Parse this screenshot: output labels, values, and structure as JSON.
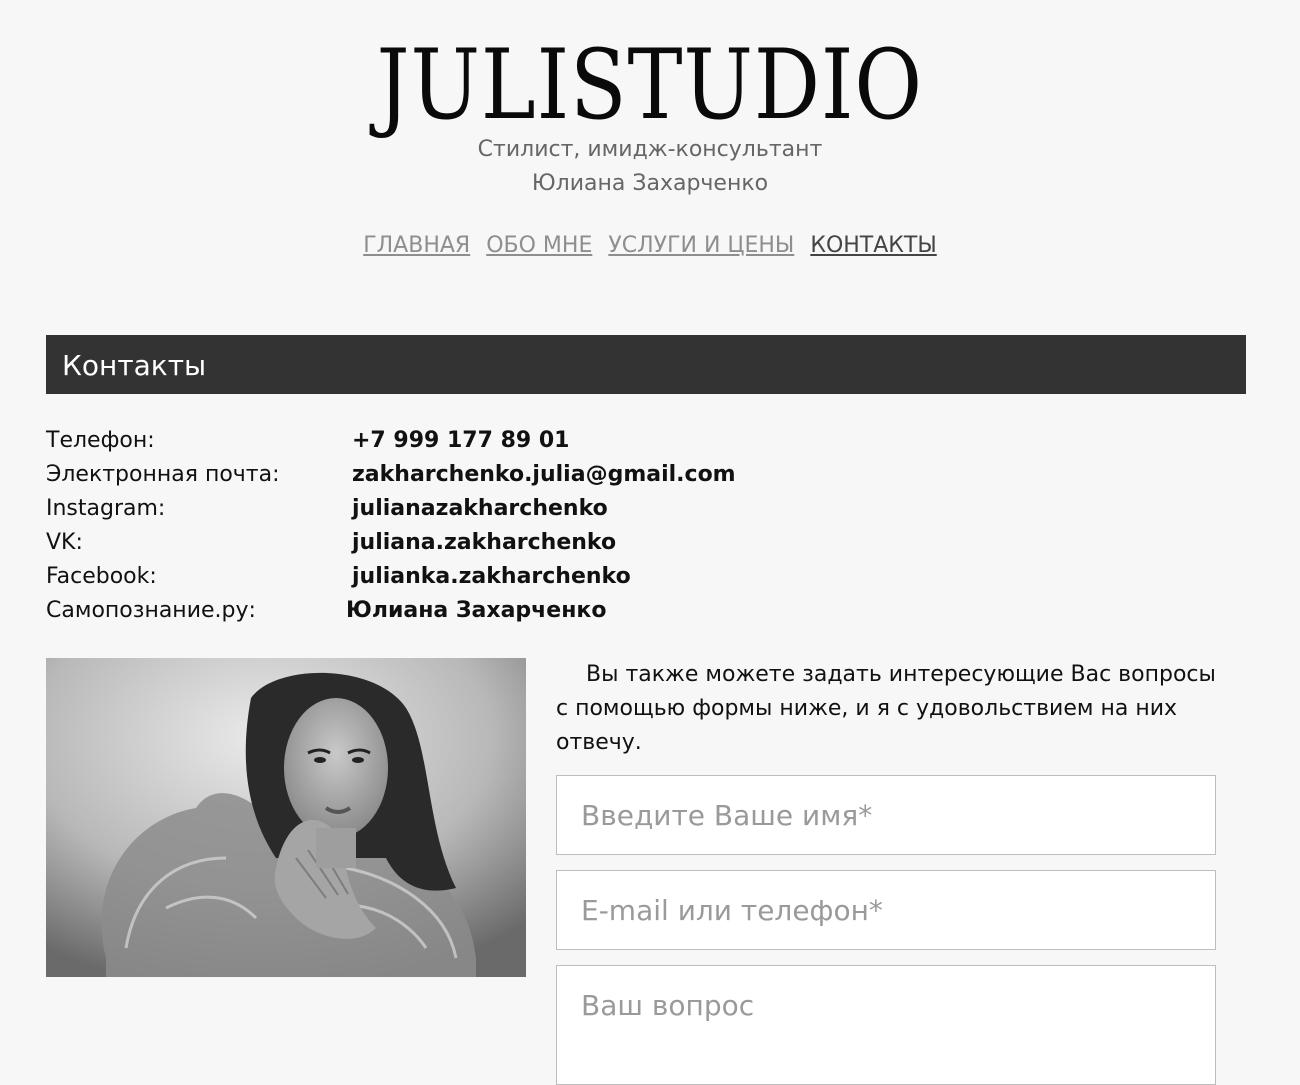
{
  "header": {
    "logo": "JULISTUDIO",
    "subtitle_line1": "Стилист, имидж-консультант",
    "subtitle_line2": "Юлиана Захарченко"
  },
  "nav": {
    "items": [
      {
        "label": "ГЛАВНАЯ"
      },
      {
        "label": "ОБО МНЕ"
      },
      {
        "label": "УСЛУГИ И ЦЕНЫ"
      },
      {
        "label": "КОНТАКТЫ"
      }
    ],
    "active": "КОНТАКТЫ"
  },
  "section": {
    "title": "Контакты"
  },
  "contacts": [
    {
      "label": "Телефон:",
      "value": "+7 999 177 89 01"
    },
    {
      "label": "Электронная почта:",
      "value": "zakharchenko.julia@gmail.com"
    },
    {
      "label": "Instagram:",
      "value": "julianazakharchenko"
    },
    {
      "label": "VK:",
      "value": "juliana.zakharchenko"
    },
    {
      "label": "Facebook:",
      "value": "julianka.zakharchenko"
    },
    {
      "label": "Самопознание.ру:",
      "value": "Юлиана Захарченко"
    }
  ],
  "form": {
    "intro": "Вы также можете задать интересующие Вас вопросы с помощью формы ниже, и я с удовольствием на них отвечу.",
    "name_placeholder": "Введите Ваше имя*",
    "contact_placeholder": "E-mail или телефон*",
    "question_placeholder": "Ваш вопрос"
  },
  "colors": {
    "background": "#f7f7f7",
    "section_bar": "#333333",
    "nav_link": "#8e8e8e",
    "nav_active": "#444444"
  }
}
